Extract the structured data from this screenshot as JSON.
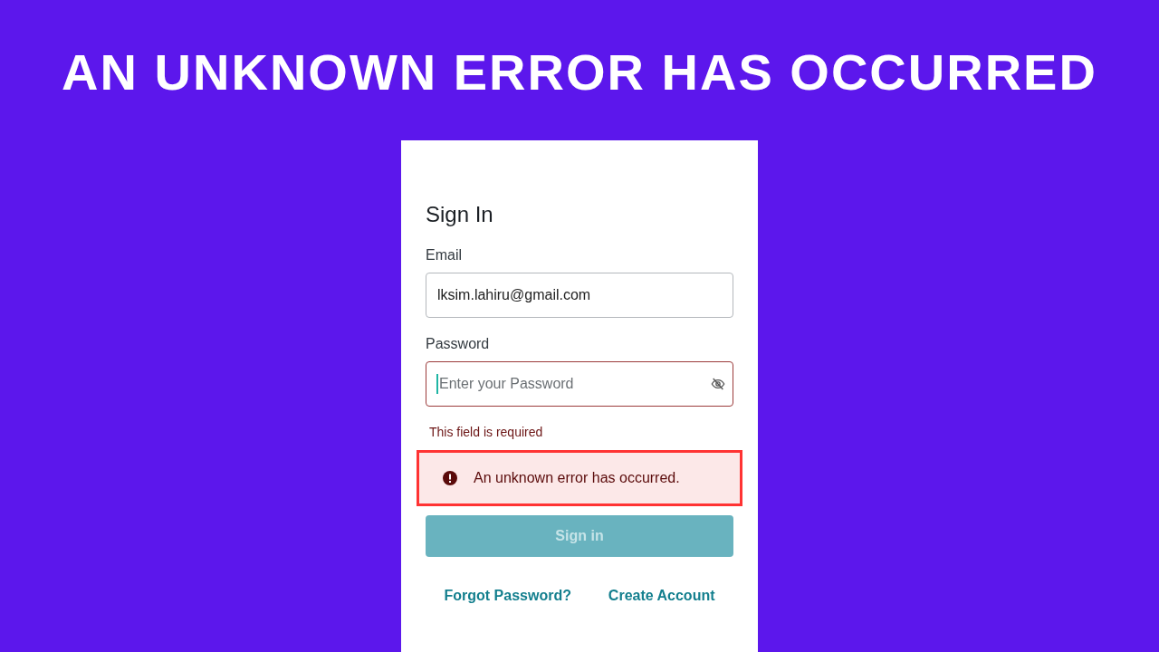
{
  "headline": "AN UNKNOWN ERROR HAS OCCURRED",
  "form": {
    "title": "Sign In",
    "fields": [
      {
        "kind": "email",
        "label": "Email",
        "value": "lksim.lahiru@gmail.com",
        "invalid": false,
        "focused": false
      },
      {
        "kind": "password",
        "label": "Password",
        "placeholder": "Enter your Password",
        "invalid": true,
        "focused": true,
        "error": "This field is required"
      }
    ],
    "alert": {
      "message": "An unknown error has occurred.",
      "highlighted": true
    },
    "submit": {
      "label": "Sign in",
      "disabled": true
    },
    "links": [
      "Forgot Password?",
      "Create Account"
    ]
  }
}
